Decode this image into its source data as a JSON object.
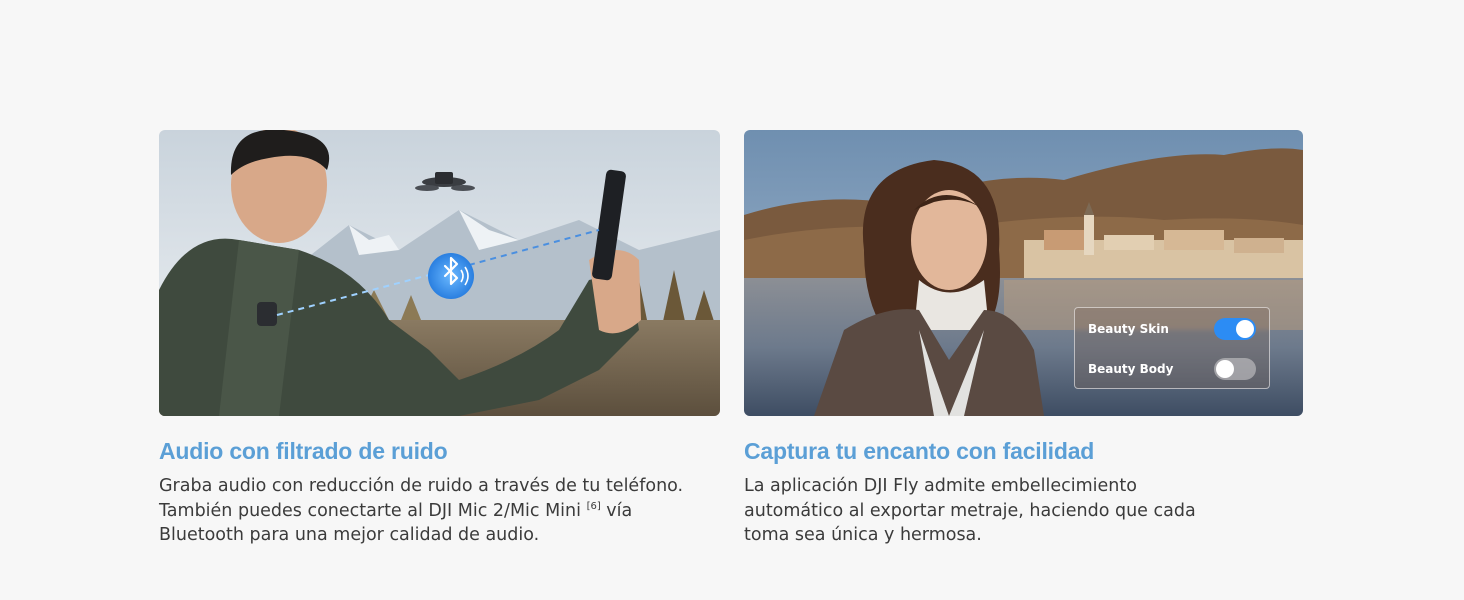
{
  "cards": [
    {
      "title": "Audio con filtrado de ruido",
      "description_line1": "Graba audio con reducción de ruido a través de tu teléfono.",
      "description_line2a": "También puedes conectarte al DJI Mic 2/Mic Mini ",
      "description_sup": "[6]",
      "description_line2b": " vía",
      "description_line3": "Bluetooth para una mejor calidad de audio.",
      "image_icon": "bluetooth-icon"
    },
    {
      "title": "Captura tu encanto con facilidad",
      "description_line1": "La aplicación DJI Fly admite embellecimiento",
      "description_line2": "automático al exportar metraje, haciendo que cada",
      "description_line3": "toma sea única y hermosa.",
      "toggles": [
        {
          "label": "Beauty Skin",
          "state": "on"
        },
        {
          "label": "Beauty Body",
          "state": "off"
        }
      ]
    }
  ],
  "colors": {
    "accent": "#5b9fd6",
    "toggle_on": "#2c8cf4",
    "text": "#3b3b3b",
    "background": "#f7f7f7"
  }
}
